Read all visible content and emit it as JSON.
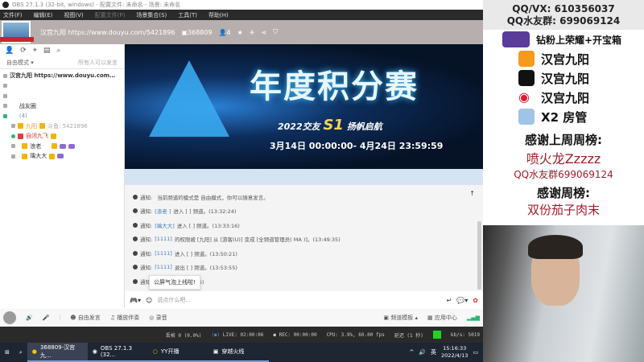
{
  "window": {
    "title": "OBS 27.1.3 (32-bit, windows) - 配置文件: 未命名 - 场景: 未命名",
    "controls": [
      "—",
      "❐",
      "✕"
    ]
  },
  "menu": [
    "文件(F)",
    "编辑(E)",
    "视图(V)",
    "配置文件(P)",
    "场景集合(S)",
    "工具(T)",
    "帮助(H)"
  ],
  "yy": {
    "channel_title": "汉宫九阳 https://www.douyu.com/5421896",
    "channel_id": "368809",
    "online": "4",
    "header_icons": [
      "video",
      "home",
      "list",
      "gamepad",
      "download",
      "minimize",
      "maximize",
      "power"
    ]
  },
  "left": {
    "mode": "自由模式 ▾",
    "mode_hint": "所有人可以发言",
    "tree": [
      {
        "label": "汉宫九阳 https://www.douyu.com…",
        "bold": true
      },
      {
        "label": ""
      },
      {
        "label": ""
      },
      {
        "label": "战友圈"
      },
      {
        "label": "(4)"
      },
      {
        "label": "九阳",
        "extra": "斗鱼: 5421896",
        "color": "#e0a020"
      },
      {
        "label": "自闭九飞",
        "color": "#d03030"
      },
      {
        "label": "浪老"
      },
      {
        "label": "瑀大大"
      }
    ]
  },
  "banner": {
    "title": "年度积分赛",
    "sub1": "2022交友",
    "sub_s1": "S1",
    "sub2": "扬帆启航",
    "date": "3月14日 00:00:00- 4月24日 23:59:59"
  },
  "chat": {
    "messages": [
      {
        "pre": "通知:",
        "text": "当前频道的模式是 自由模式，你可以随意发言。"
      },
      {
        "pre": "通知:",
        "user": "[浪老      ]",
        "text": "进入 [    ] 频道。(13:32:24)"
      },
      {
        "pre": "通知:",
        "user": "[瑀大大]",
        "text": "进入 [    ] 频道。(13:33:16)"
      },
      {
        "pre": "通知:",
        "user": "[1111]",
        "text": "的权限被 [九阳] 从 [游客(U)] 变成 [全频道管理员( MA )]。(13:49:35)"
      },
      {
        "pre": "通知:",
        "user": "[1111]",
        "text": "进入 [    ] 频道。(13:50:21)"
      },
      {
        "pre": "通知:",
        "user": "[1111]",
        "text": "退出 [    ] 频道。(13:53:55)"
      },
      {
        "pre": "通知:",
        "user": "",
        "text": "               ] 频道。(15:09:25)"
      }
    ],
    "tooltip": "公屏气泡上线啦!",
    "input_placeholder": "说点什么吧..."
  },
  "bottombar": {
    "free_speak": "自由发言",
    "play_music": "播放伴奏",
    "record": "录音",
    "channel_template": "频道模板 ▴",
    "app_center": "应用中心"
  },
  "obs_status": {
    "dropped": "丢帧 0 (0.0%)",
    "live": "LIVE: 02:00:06",
    "rec": "REC: 00:00:00",
    "cpu": "CPU: 3.9%, 60.00 fps",
    "delay": "延迟 (1 秒)",
    "kbps": "kb/s: 5019"
  },
  "taskbar": {
    "apps": [
      "368809-汉宫九...",
      "OBS 27.1.3 (32...",
      "YY开播",
      "穿越火线"
    ],
    "lang": "英",
    "time": "15:16:33",
    "date": "2022/4/13"
  },
  "overlay": {
    "qq": "QQ/VX: 610356037",
    "qqgroup": "QQ水友群: 699069124",
    "diamond": "钻粉上荣耀+开宝箱",
    "socials": [
      {
        "label": "汉宫九阳",
        "color": "#f59a1b"
      },
      {
        "label": "汉宫九阳",
        "color": "#111111"
      },
      {
        "label": "汉宫九阳",
        "color": "#e6162d"
      },
      {
        "label": "X2 房管",
        "color": "#9ec4e6"
      }
    ],
    "thanks_last_week": "感谢上周周榜:",
    "last_week_name": "喷火龙Zzzzz",
    "last_week_group": "QQ水友群699069124",
    "thanks_week": "感谢周榜:",
    "week_name": "双份茄子肉末"
  }
}
